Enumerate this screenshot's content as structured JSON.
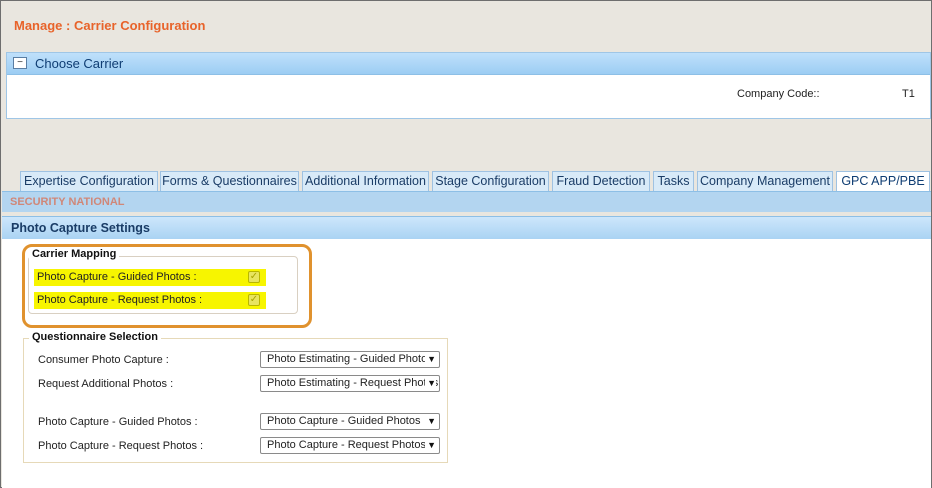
{
  "page": {
    "title": "Manage : Carrier Configuration"
  },
  "choose_carrier": {
    "title": "Choose Carrier",
    "collapse_symbol": "−",
    "company_code_label": "Company Code::",
    "company_code_value": "T1"
  },
  "tabs": [
    {
      "label": "Expertise Configuration",
      "active": false
    },
    {
      "label": "Forms & Questionnaires",
      "active": false
    },
    {
      "label": "Additional Information",
      "active": false
    },
    {
      "label": "Stage Configuration",
      "active": false
    },
    {
      "label": "Fraud Detection",
      "active": false
    },
    {
      "label": "Tasks",
      "active": false
    },
    {
      "label": "Company Management",
      "active": false
    },
    {
      "label": "GPC APP/PBE",
      "active": true
    }
  ],
  "carrier_name": "SECURITY NATIONAL",
  "photo_capture": {
    "title": "Photo Capture Settings",
    "carrier_mapping": {
      "legend": "Carrier Mapping",
      "rows": [
        {
          "label": "Photo Capture - Guided Photos :",
          "checked": true
        },
        {
          "label": "Photo Capture - Request Photos :",
          "checked": true
        }
      ]
    },
    "questionnaire_selection": {
      "legend": "Questionnaire Selection",
      "rows": [
        {
          "label": "Consumer Photo Capture :",
          "selected": "Photo Estimating - Guided Photos"
        },
        {
          "label": "Request Additional Photos :",
          "selected": "Photo Estimating - Request Photos"
        },
        {
          "label": "Photo Capture - Guided Photos :",
          "selected": "Photo Capture - Guided Photos"
        },
        {
          "label": "Photo Capture - Request Photos :",
          "selected": "Photo Capture - Request Photos"
        }
      ]
    }
  },
  "colors": {
    "title_orange": "#e8632a",
    "highlight_yellow": "#f7f500",
    "callout_orange": "#e0922e",
    "header_blue": "#9ccdf3"
  },
  "icons": {
    "collapse": "minus-icon",
    "dropdown": "chevron-down-icon",
    "checkbox": "check-icon"
  }
}
